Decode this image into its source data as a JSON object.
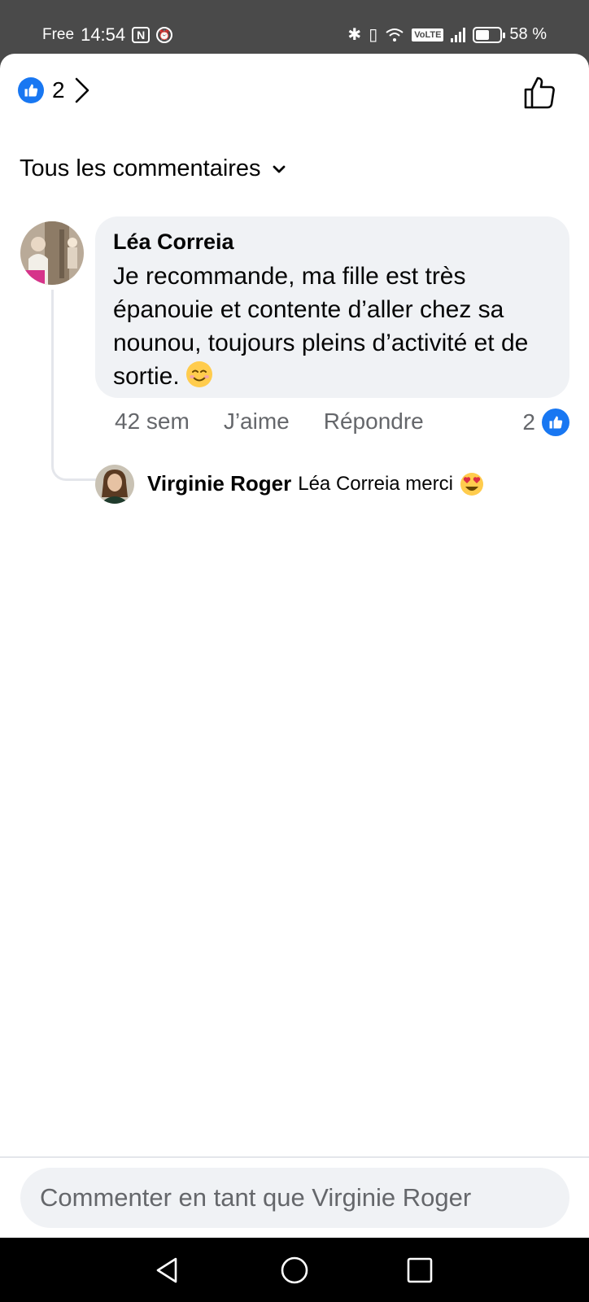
{
  "status_bar": {
    "carrier": "Free",
    "time": "14:54",
    "network": "VoLTE",
    "battery": "58 %",
    "battery_level": 0.58
  },
  "header": {
    "reaction_count": "2",
    "icons": [
      "like-icon",
      "chevron-right-icon",
      "thumbs-up-outline-icon"
    ]
  },
  "filter": {
    "label": "Tous les commentaires"
  },
  "comment": {
    "author": "Léa Correia",
    "text": "Je recommande, ma fille est très épanouie et contente d’aller chez sa nounou, toujours pleins d’activité et de sortie.",
    "emoji": "smiling-face-icon",
    "time": "42 sem",
    "like_label": "J’aime",
    "reply_label": "Répondre",
    "like_count": "2"
  },
  "reply": {
    "author": "Virginie Roger",
    "text": "Léa Correia merci",
    "emoji": "heart-eyes-icon"
  },
  "composer": {
    "placeholder": "Commenter en tant que Virginie Roger"
  },
  "colors": {
    "accent": "#1877f2",
    "bubble": "#f0f2f5",
    "secondary_text": "#65676b"
  }
}
